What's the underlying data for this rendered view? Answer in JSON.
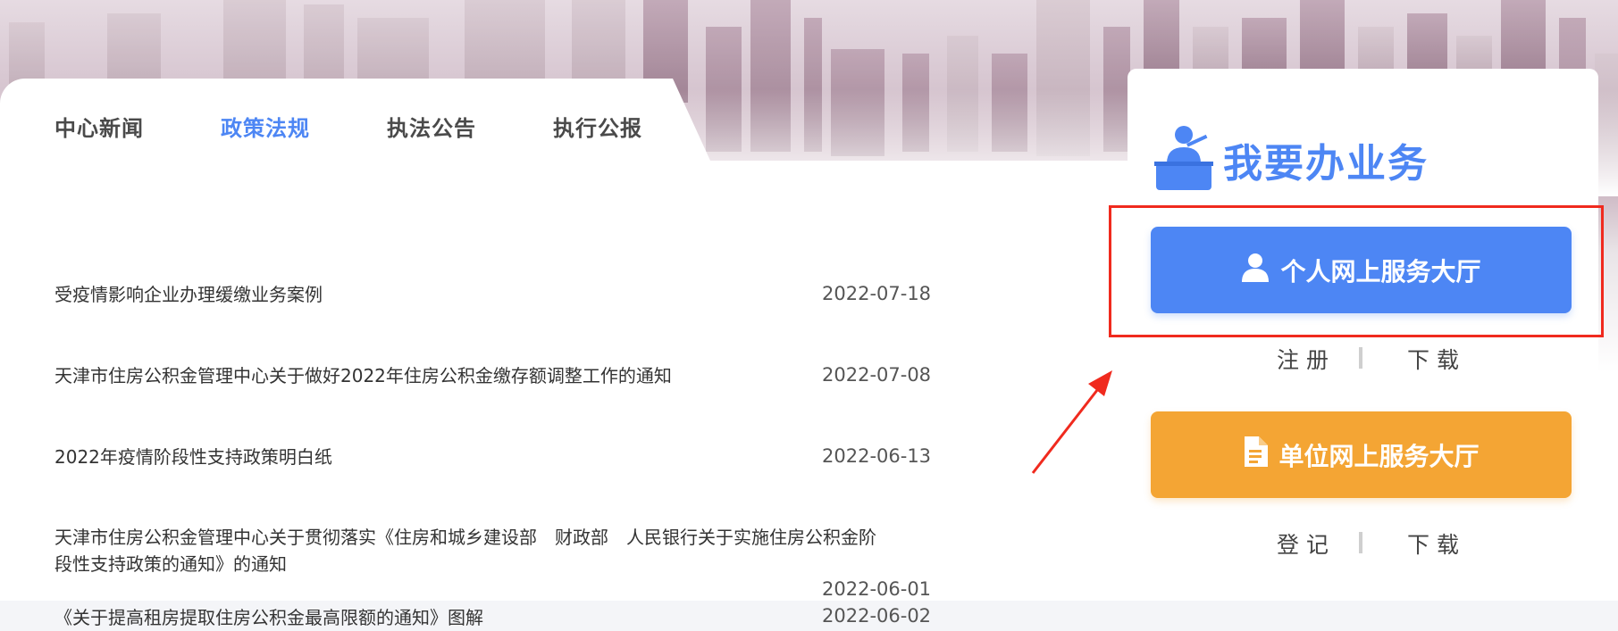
{
  "tabs": [
    {
      "label": "中心新闻",
      "active": false
    },
    {
      "label": "政策法规",
      "active": true
    },
    {
      "label": "执法公告",
      "active": false
    },
    {
      "label": "执行公报",
      "active": false
    }
  ],
  "news": [
    {
      "title": "受疫情影响企业办理缓缴业务案例",
      "date": "2022-07-18"
    },
    {
      "title": "天津市住房公积金管理中心关于做好2022年住房公积金缴存额调整工作的通知",
      "date": "2022-07-08"
    },
    {
      "title": "2022年疫情阶段性支持政策明白纸",
      "date": "2022-06-13"
    },
    {
      "title_line1": "天津市住房公积金管理中心关于贯彻落实《住房和城乡建设部　财政部　人民银行关于实施住房公积金阶",
      "title_line2": "段性支持政策的通知》的通知",
      "date": "2022-06-01"
    },
    {
      "title": "《关于提高租房提取住房公积金最高限额的通知》图解",
      "date": "2022-06-02"
    }
  ],
  "service": {
    "title": "我要办业务",
    "personal_button": "个人网上服务大厅",
    "personal_links": [
      "注册",
      "下载"
    ],
    "company_button": "单位网上服务大厅",
    "company_links": [
      "登记",
      "下载"
    ]
  },
  "colors": {
    "accent": "#4d86f4",
    "orange": "#f4a534",
    "annotation": "#f02a1e"
  },
  "icons": [
    "desk-person-icon",
    "user-icon",
    "document-icon"
  ]
}
